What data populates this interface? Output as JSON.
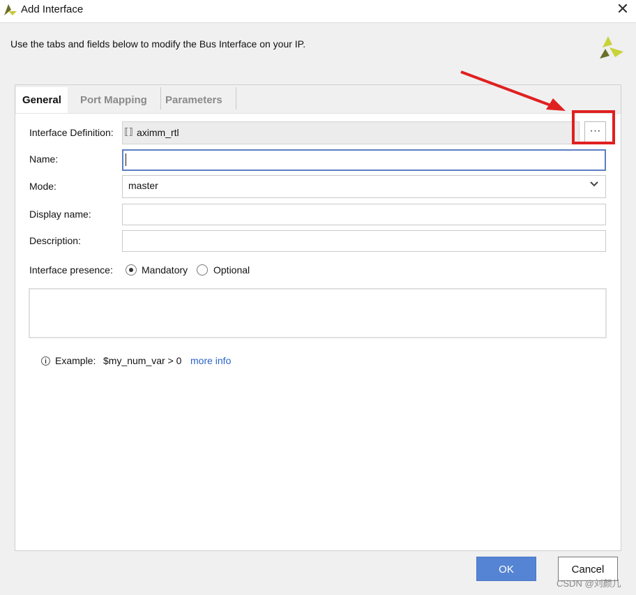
{
  "window": {
    "title": "Add Interface",
    "close_glyph": "✕",
    "app_icon": "vivado-logo-icon"
  },
  "instruction": "Use the tabs and fields below to modify the Bus Interface on your IP.",
  "tabs": [
    {
      "label": "General",
      "active": true
    },
    {
      "label": "Port Mapping",
      "active": false
    },
    {
      "label": "Parameters",
      "active": false
    }
  ],
  "form": {
    "interface_definition": {
      "label": "Interface Definition:",
      "value": "aximm_rtl",
      "browse_label": "···"
    },
    "name": {
      "label": "Name:",
      "value": ""
    },
    "mode": {
      "label": "Mode:",
      "value": "master"
    },
    "display_name": {
      "label": "Display name:",
      "value": ""
    },
    "description": {
      "label": "Description:",
      "value": ""
    },
    "presence": {
      "label": "Interface presence:",
      "options": [
        {
          "label": "Mandatory",
          "selected": true
        },
        {
          "label": "Optional",
          "selected": false
        }
      ]
    }
  },
  "hint": {
    "info_glyph": "i",
    "prefix": "Example:",
    "code": "$my_num_var > 0",
    "link": "more info"
  },
  "buttons": {
    "ok": "OK",
    "cancel": "Cancel"
  },
  "annotation": {
    "color": "#e02020"
  },
  "watermark": "CSDN @刘颜儿",
  "colors": {
    "accent": "#5684d4",
    "link": "#2a63c8",
    "focus_border": "#5b7fc4"
  }
}
